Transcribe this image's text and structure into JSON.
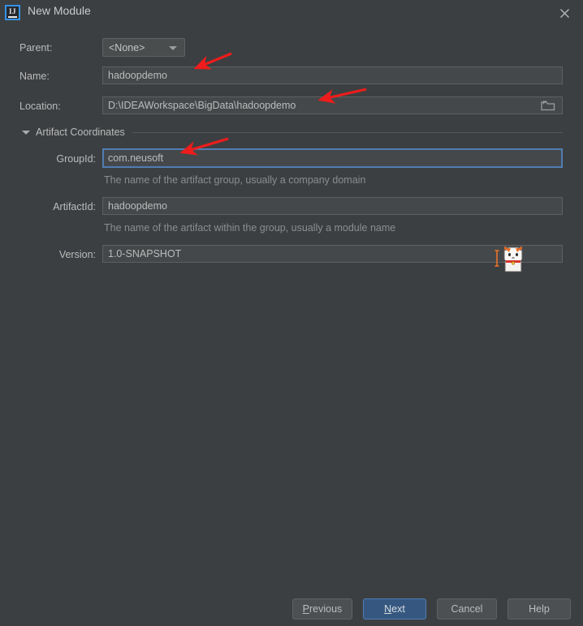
{
  "window": {
    "title": "New Module",
    "app_icon_name": "intellij-idea-icon",
    "app_icon_text": "IJ",
    "close_icon": "close-icon"
  },
  "form": {
    "parent": {
      "label": "Parent:",
      "value": "<None>",
      "arrow_icon": "chevron-down-icon"
    },
    "name": {
      "label": "Name:",
      "value": "hadoopdemo"
    },
    "location": {
      "label": "Location:",
      "value": "D:\\IDEAWorkspace\\BigData\\hadoopdemo",
      "browse_icon": "folder-icon"
    },
    "artifact_section": {
      "label": "Artifact Coordinates",
      "expanded": true,
      "toggle_icon": "triangle-down-icon"
    },
    "group_id": {
      "label": "GroupId:",
      "value": "com.neusoft",
      "helper": "The name of the artifact group, usually a company domain",
      "focused": true
    },
    "artifact_id": {
      "label": "ArtifactId:",
      "value": "hadoopdemo",
      "helper": "The name of the artifact within the group, usually a module name"
    },
    "version": {
      "label": "Version:",
      "value": "1.0-SNAPSHOT"
    }
  },
  "buttons": {
    "previous": {
      "label": "Previous",
      "mnemonic": "P"
    },
    "next": {
      "label": "Next",
      "mnemonic": "N",
      "primary": true
    },
    "cancel": {
      "label": "Cancel"
    },
    "help": {
      "label": "Help"
    }
  },
  "annotations": {
    "arrow_color": "#ee1c1c",
    "count": 3,
    "targets": [
      "name-field",
      "location-field",
      "group-id-field"
    ]
  },
  "cursor": {
    "type": "custom-cat-cursor",
    "caret_icon": "text-ibeam-caret"
  },
  "colors": {
    "background": "#3c3f41",
    "field_background": "#45484a",
    "field_border": "#5e6060",
    "focus_border": "#5781b5",
    "primary_button": "#365880",
    "text": "#bbbbbb",
    "helper_text": "#8b8d8f",
    "accent": "#3592e8"
  }
}
